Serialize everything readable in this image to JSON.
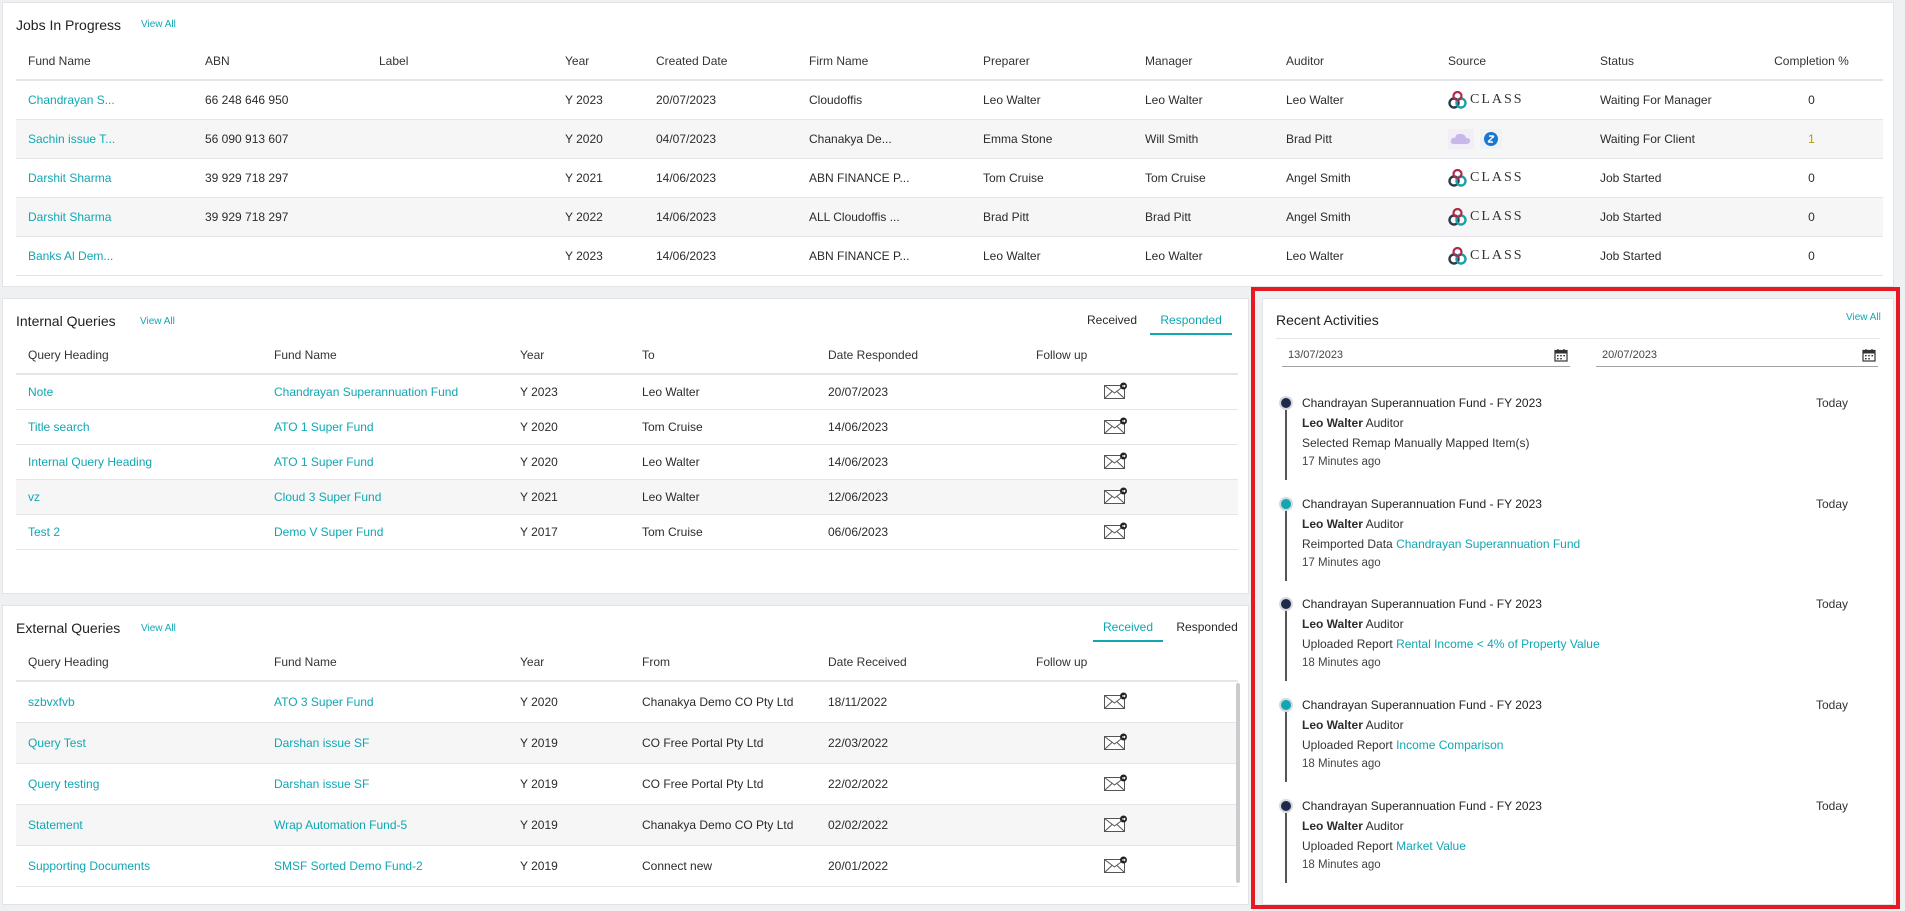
{
  "jobs": {
    "title": "Jobs In Progress",
    "view_all": "View All",
    "columns": [
      "Fund Name",
      "ABN",
      "Label",
      "Year",
      "Created Date",
      "Firm Name",
      "Preparer",
      "Manager",
      "Auditor",
      "Source",
      "Status",
      "Completion %"
    ],
    "rows": [
      {
        "fund": "Chandrayan S...",
        "abn": "66 248 646 950",
        "label": "",
        "year": "Y 2023",
        "created": "20/07/2023",
        "firm": "Cloudoffis",
        "preparer": "Leo Walter",
        "manager": "Leo Walter",
        "auditor": "Leo Walter",
        "source": "class",
        "status": "Waiting For Manager",
        "completion": "0"
      },
      {
        "fund": "Sachin issue T...",
        "abn": "56 090 913 607",
        "label": "",
        "year": "Y 2020",
        "created": "04/07/2023",
        "firm": "Chanakya De...",
        "preparer": "Emma Stone",
        "manager": "Will Smith",
        "auditor": "Brad Pitt",
        "source": "cloud",
        "status": "Waiting For Client",
        "completion": "1"
      },
      {
        "fund": "Darshit Sharma",
        "abn": "39 929 718 297",
        "label": "",
        "year": "Y 2021",
        "created": "14/06/2023",
        "firm": "ABN FINANCE P...",
        "preparer": "Tom Cruise",
        "manager": "Tom Cruise",
        "auditor": "Angel Smith",
        "source": "class",
        "status": "Job Started",
        "completion": "0"
      },
      {
        "fund": "Darshit Sharma",
        "abn": "39 929 718 297",
        "label": "",
        "year": "Y 2022",
        "created": "14/06/2023",
        "firm": "ALL Cloudoffis ...",
        "preparer": "Brad Pitt",
        "manager": "Brad Pitt",
        "auditor": "Angel Smith",
        "source": "class",
        "status": "Job Started",
        "completion": "0"
      },
      {
        "fund": "Banks Al Dem...",
        "abn": "",
        "label": "",
        "year": "Y 2023",
        "created": "14/06/2023",
        "firm": "ABN FINANCE P...",
        "preparer": "Leo Walter",
        "manager": "Leo Walter",
        "auditor": "Leo Walter",
        "source": "class",
        "status": "Job Started",
        "completion": "0"
      }
    ],
    "class_logo_text": "CLASS"
  },
  "internal": {
    "title": "Internal Queries",
    "view_all": "View All",
    "tabs": [
      "Received",
      "Responded"
    ],
    "active_tab": "Responded",
    "columns": [
      "Query Heading",
      "Fund Name",
      "Year",
      "To",
      "Date Responded",
      "Follow up"
    ],
    "rows": [
      {
        "heading": "Note",
        "fund": "Chandrayan Superannuation Fund",
        "year": "Y 2023",
        "to": "Leo Walter",
        "date": "20/07/2023"
      },
      {
        "heading": "Title search",
        "fund": "ATO 1 Super Fund",
        "year": "Y 2020",
        "to": "Tom Cruise",
        "date": "14/06/2023"
      },
      {
        "heading": "Internal Query Heading",
        "fund": "ATO 1 Super Fund",
        "year": "Y 2020",
        "to": "Leo Walter",
        "date": "14/06/2023"
      },
      {
        "heading": "vz",
        "fund": "Cloud 3 Super Fund",
        "year": "Y 2021",
        "to": "Leo Walter",
        "date": "12/06/2023"
      },
      {
        "heading": "Test 2",
        "fund": "Demo V Super Fund",
        "year": "Y 2017",
        "to": "Tom Cruise",
        "date": "06/06/2023"
      }
    ]
  },
  "external": {
    "title": "External Queries",
    "view_all": "View All",
    "tabs": [
      "Received",
      "Responded"
    ],
    "active_tab": "Received",
    "columns": [
      "Query Heading",
      "Fund Name",
      "Year",
      "From",
      "Date Received",
      "Follow up"
    ],
    "rows": [
      {
        "heading": "szbvxfvb",
        "fund": "ATO 3 Super Fund",
        "year": "Y 2020",
        "from": "Chanakya Demo CO Pty Ltd",
        "date": "18/11/2022"
      },
      {
        "heading": "Query Test",
        "fund": "Darshan issue SF",
        "year": "Y 2019",
        "from": "CO Free Portal Pty Ltd",
        "date": "22/03/2022"
      },
      {
        "heading": "Query testing",
        "fund": "Darshan issue SF",
        "year": "Y 2019",
        "from": "CO Free Portal Pty Ltd",
        "date": "22/02/2022"
      },
      {
        "heading": "Statement",
        "fund": "Wrap Automation Fund-5",
        "year": "Y 2019",
        "from": "Chanakya Demo CO Pty Ltd",
        "date": "02/02/2022"
      },
      {
        "heading": "Supporting Documents",
        "fund": "SMSF Sorted Demo Fund-2",
        "year": "Y 2019",
        "from": "Connect new",
        "date": "20/01/2022"
      }
    ]
  },
  "activities": {
    "title": "Recent Activities",
    "view_all": "View All",
    "date_from": "13/07/2023",
    "date_to": "20/07/2023",
    "items": [
      {
        "fund": "Chandrayan Superannuation Fund - FY 2023",
        "user": "Leo Walter",
        "role": "Auditor",
        "action": "Selected Remap Manually Mapped Item(s)",
        "link": "",
        "time": "17 Minutes ago",
        "day": "Today",
        "dot": "dark"
      },
      {
        "fund": "Chandrayan Superannuation Fund - FY 2023",
        "user": "Leo Walter",
        "role": "Auditor",
        "action": "Reimported Data",
        "link": "Chandrayan Superannuation Fund",
        "time": "17 Minutes ago",
        "day": "Today",
        "dot": "teal"
      },
      {
        "fund": "Chandrayan Superannuation Fund - FY 2023",
        "user": "Leo Walter",
        "role": "Auditor",
        "action": "Uploaded Report",
        "link": "Rental Income < 4% of Property Value",
        "time": "18 Minutes ago",
        "day": "Today",
        "dot": "dark"
      },
      {
        "fund": "Chandrayan Superannuation Fund - FY 2023",
        "user": "Leo Walter",
        "role": "Auditor",
        "action": "Uploaded Report",
        "link": "Income Comparison",
        "time": "18 Minutes ago",
        "day": "Today",
        "dot": "teal"
      },
      {
        "fund": "Chandrayan Superannuation Fund - FY 2023",
        "user": "Leo Walter",
        "role": "Auditor",
        "action": "Uploaded Report",
        "link": "Market Value",
        "time": "18 Minutes ago",
        "day": "Today",
        "dot": "dark"
      }
    ]
  },
  "colors": {
    "accent": "#10a7b3",
    "highlight": "#e51b23",
    "dot_dark": "#1e2a4a",
    "dot_teal": "#10a7b3"
  }
}
